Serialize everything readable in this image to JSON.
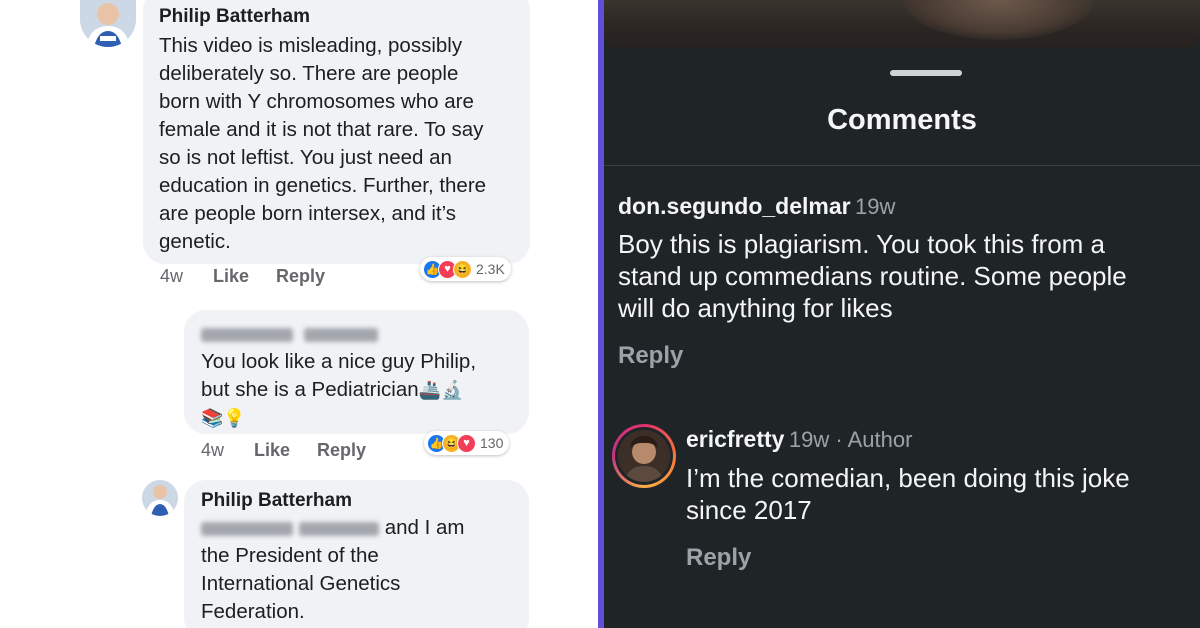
{
  "facebook": {
    "comment1": {
      "author": "Philip Batterham",
      "lines": [
        "This video is misleading, possibly",
        "deliberately so.  There are people",
        "born with Y chromosomes who are",
        "female and it is not that rare. To say",
        "so is not leftist.  You just need an",
        "education in genetics.  Further, there",
        "are people born intersex, and it’s",
        "genetic."
      ],
      "time": "4w",
      "like_label": "Like",
      "reply_label": "Reply",
      "reaction_count": "2.3K",
      "reactions": [
        "like-icon",
        "love-icon",
        "haha-icon"
      ]
    },
    "comment2": {
      "author_redacted": true,
      "lines": [
        "You look like a nice guy Philip,",
        "but she is a Pediatrician"
      ],
      "time": "4w",
      "like_label": "Like",
      "reply_label": "Reply",
      "reaction_count": "130",
      "reactions": [
        "like-icon",
        "haha-icon",
        "love-icon"
      ]
    },
    "comment3": {
      "author": "Philip Batterham",
      "tag_suffix": " and I am",
      "lines": [
        "the President of the",
        "International Genetics",
        "Federation."
      ]
    }
  },
  "instagram": {
    "title": "Comments",
    "comment1": {
      "username": "don.segundo_delmar",
      "time": "19w",
      "lines": [
        "Boy this is plagiarism. You took this from a",
        "stand up commedians routine. Some people",
        "will do anything for likes"
      ],
      "reply_label": "Reply"
    },
    "comment2": {
      "username": "ericfretty",
      "meta": "19w · Author",
      "lines": [
        "I’m the comedian, been doing this joke",
        "since 2017"
      ],
      "reply_label": "Reply"
    }
  },
  "colors": {
    "divider": "#5f4fd9",
    "fb_bubble": "#f0f2f5",
    "ig_background": "#1f2427",
    "like_blue": "#1877f2",
    "love_red": "#f33e58",
    "haha_yellow": "#f7b125"
  }
}
